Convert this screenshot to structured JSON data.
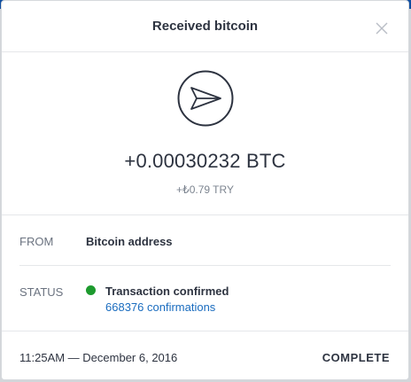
{
  "dialog": {
    "title": "Received bitcoin",
    "close_icon": "close-icon",
    "transaction_icon": "send-arrow-icon"
  },
  "amount": {
    "crypto": "+0.00030232 BTC",
    "fiat": "+₺0.79 TRY"
  },
  "details": {
    "from_label": "FROM",
    "from_value": "Bitcoin address",
    "status_label": "STATUS",
    "status_value": "Transaction confirmed",
    "status_color": "#1d9a2e",
    "confirmations": "668376 confirmations"
  },
  "footer": {
    "timestamp": "11:25AM — December 6, 2016",
    "state": "COMPLETE"
  },
  "colors": {
    "text": "#2d3340",
    "muted": "#6b7380",
    "link": "#1a6cbf",
    "success": "#1d9a2e"
  }
}
